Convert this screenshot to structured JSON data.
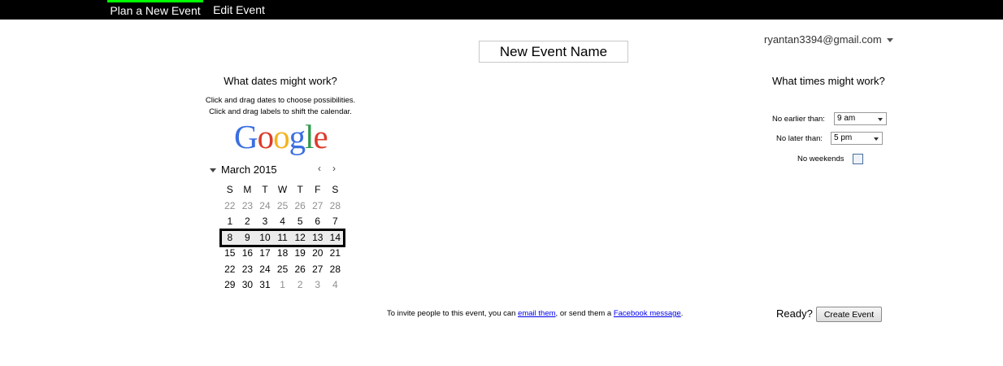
{
  "nav": {
    "tabs": [
      {
        "label": "Plan a New Event",
        "active": true
      },
      {
        "label": "Edit Event",
        "active": false
      }
    ]
  },
  "account": {
    "email": "ryantan3394@gmail.com"
  },
  "event_name": {
    "value": "New Event Name"
  },
  "dates": {
    "heading": "What dates might work?",
    "help_line1": "Click and drag dates to choose possibilities.",
    "help_line2": "Click and drag labels to shift the calendar.",
    "logo": {
      "G": "G",
      "o1": "o",
      "o2": "o",
      "g": "g",
      "l": "l",
      "e": "e"
    },
    "calendar": {
      "month_label": "March 2015",
      "prev_icon": "‹",
      "next_icon": "›",
      "weekday_headers": [
        "S",
        "M",
        "T",
        "W",
        "T",
        "F",
        "S"
      ],
      "weeks": [
        [
          "22",
          "23",
          "24",
          "25",
          "26",
          "27",
          "28"
        ],
        [
          "1",
          "2",
          "3",
          "4",
          "5",
          "6",
          "7"
        ],
        [
          "8",
          "9",
          "10",
          "11",
          "12",
          "13",
          "14"
        ],
        [
          "15",
          "16",
          "17",
          "18",
          "19",
          "20",
          "21"
        ],
        [
          "22",
          "23",
          "24",
          "25",
          "26",
          "27",
          "28"
        ],
        [
          "29",
          "30",
          "31",
          "1",
          "2",
          "3",
          "4"
        ]
      ],
      "selected_week_index": 2
    }
  },
  "times": {
    "heading": "What times might work?",
    "earliest_label": "No earlier than:",
    "earliest_value": "9 am",
    "latest_label": "No later than:",
    "latest_value": "5 pm",
    "weekends_label": "No weekends",
    "weekends_checked": false
  },
  "invite": {
    "text_before": "To invite people to this event, you can ",
    "email_link": "email them",
    "text_middle": ", or send them a ",
    "facebook_link": "Facebook message",
    "text_after": "."
  },
  "footer": {
    "ready_label": "Ready?",
    "create_button": "Create Event"
  },
  "colors": {
    "topbar": "#000000",
    "active_tab_accent": "#00ff00",
    "link": "#0000ee"
  }
}
